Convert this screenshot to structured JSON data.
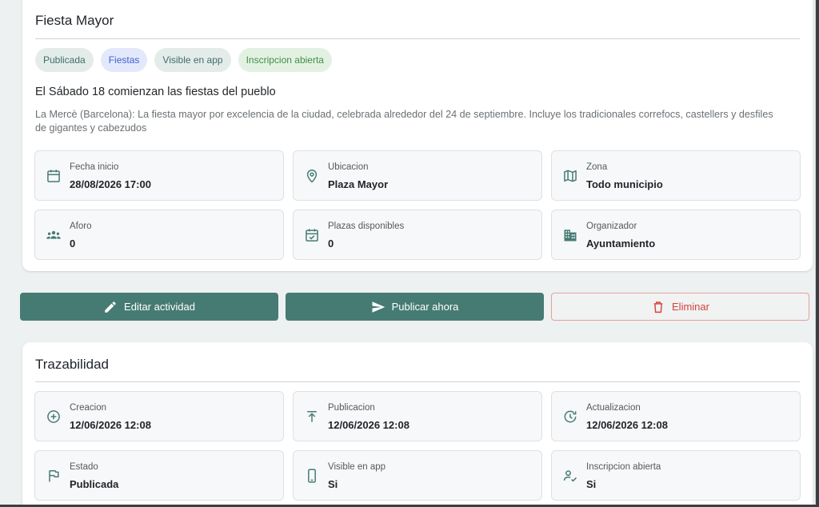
{
  "activity": {
    "title": "Fiesta Mayor",
    "chips": [
      "Publicada",
      "Fiestas",
      "Visible en app",
      "Inscripcion abierta"
    ],
    "subtitle": "El Sábado 18 comienzan las fiestas del pueblo",
    "description": "La Mercè (Barcelona): La fiesta mayor por excelencia de la ciudad, celebrada alrededor del 24 de septiembre. Incluye los tradicionales correfocs, castellers y desfiles de gigantes y cabezudos",
    "fields": [
      {
        "label": "Fecha inicio",
        "value": "28/08/2026 17:00",
        "icon": "calendar-icon"
      },
      {
        "label": "Ubicacion",
        "value": "Plaza Mayor",
        "icon": "location-pin-icon"
      },
      {
        "label": "Zona",
        "value": "Todo municipio",
        "icon": "map-icon"
      },
      {
        "label": "Aforo",
        "value": "0",
        "icon": "people-icon"
      },
      {
        "label": "Plazas disponibles",
        "value": "0",
        "icon": "calendar-check-icon"
      },
      {
        "label": "Organizador",
        "value": "Ayuntamiento",
        "icon": "building-icon"
      }
    ]
  },
  "actions": {
    "edit": "Editar actividad",
    "publish": "Publicar ahora",
    "delete": "Eliminar"
  },
  "traceability": {
    "title": "Trazabilidad",
    "fields": [
      {
        "label": "Creacion",
        "value": "12/06/2026 12:08",
        "icon": "add-circle-icon"
      },
      {
        "label": "Publicacion",
        "value": "12/06/2026 12:08",
        "icon": "publish-icon"
      },
      {
        "label": "Actualizacion",
        "value": "12/06/2026 12:08",
        "icon": "update-icon"
      },
      {
        "label": "Estado",
        "value": "Publicada",
        "icon": "flag-icon"
      },
      {
        "label": "Visible en app",
        "value": "Si",
        "icon": "phone-icon"
      },
      {
        "label": "Inscripcion abierta",
        "value": "Si",
        "icon": "person-check-icon"
      }
    ]
  },
  "colors": {
    "accent": "#467b74",
    "danger": "#d2443b",
    "background": "#eef1f1"
  }
}
